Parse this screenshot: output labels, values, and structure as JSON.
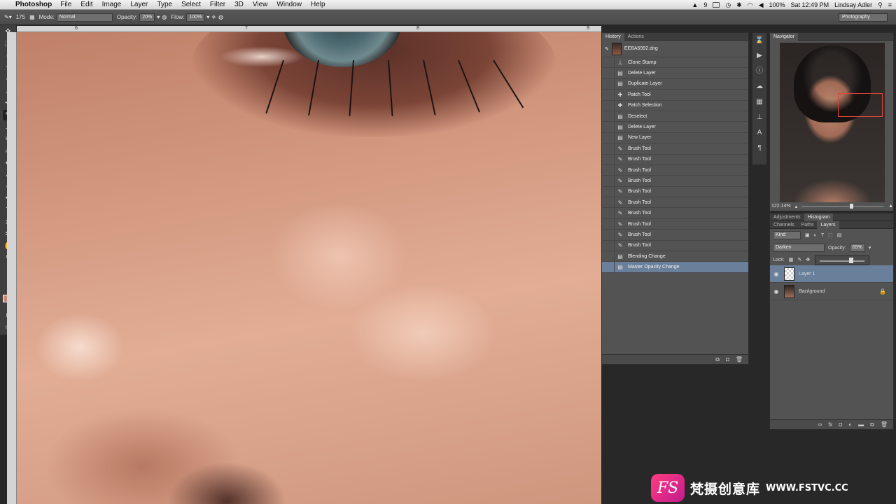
{
  "menubar": {
    "app": "Photoshop",
    "items": [
      "File",
      "Edit",
      "Image",
      "Layer",
      "Type",
      "Select",
      "Filter",
      "3D",
      "View",
      "Window",
      "Help"
    ],
    "status": {
      "battery": "100%",
      "time": "Sat 12:49 PM",
      "user": "Lindsay Adler",
      "badge": "9"
    }
  },
  "options": {
    "brush_size": "175",
    "mode_label": "Mode:",
    "mode_value": "Normal",
    "opacity_label": "Opacity:",
    "opacity_value": "20%",
    "flow_label": "Flow:",
    "flow_value": "100%",
    "workspace": "Photography"
  },
  "ruler": {
    "marks": [
      "6",
      "7",
      "8",
      "9"
    ]
  },
  "history": {
    "tabs": [
      "History",
      "Actions"
    ],
    "snapshot": "EEBA5992.dng",
    "items": [
      {
        "label": "Clone Stamp",
        "icon": "stamp-icon"
      },
      {
        "label": "Delete Layer",
        "icon": "layer-icon"
      },
      {
        "label": "Duplicate Layer",
        "icon": "layer-icon"
      },
      {
        "label": "Patch Tool",
        "icon": "patch-icon"
      },
      {
        "label": "Patch Selection",
        "icon": "patch-icon"
      },
      {
        "label": "Deselect",
        "icon": "layer-icon"
      },
      {
        "label": "Delete Layer",
        "icon": "layer-icon"
      },
      {
        "label": "New Layer",
        "icon": "layer-icon"
      },
      {
        "label": "Brush Tool",
        "icon": "brush-icon"
      },
      {
        "label": "Brush Tool",
        "icon": "brush-icon"
      },
      {
        "label": "Brush Tool",
        "icon": "brush-icon"
      },
      {
        "label": "Brush Tool",
        "icon": "brush-icon"
      },
      {
        "label": "Brush Tool",
        "icon": "brush-icon"
      },
      {
        "label": "Brush Tool",
        "icon": "brush-icon"
      },
      {
        "label": "Brush Tool",
        "icon": "brush-icon"
      },
      {
        "label": "Brush Tool",
        "icon": "brush-icon"
      },
      {
        "label": "Brush Tool",
        "icon": "brush-icon"
      },
      {
        "label": "Brush Tool",
        "icon": "brush-icon"
      },
      {
        "label": "Blending Change",
        "icon": "layer-icon"
      },
      {
        "label": "Master Opacity Change",
        "icon": "layer-icon",
        "selected": true
      }
    ]
  },
  "navigator": {
    "title": "Navigator",
    "zoom": "122.14%"
  },
  "adjust_tabs": [
    "Adjustments",
    "Histogram"
  ],
  "layers": {
    "tabs": [
      "Channels",
      "Paths",
      "Layers"
    ],
    "kind": "Kind",
    "blend_mode": "Darken",
    "opacity_label": "Opacity:",
    "opacity_value": "65%",
    "lock_label": "Lock:",
    "items": [
      {
        "name": "Layer 1",
        "selected": true,
        "thumb": "transparent"
      },
      {
        "name": "Background",
        "selected": false,
        "thumb": "portrait",
        "locked": true
      }
    ]
  },
  "watermark": {
    "text": "梵摄创意库",
    "url": "WWW.FSTVC.CC",
    "logo": "FS"
  }
}
